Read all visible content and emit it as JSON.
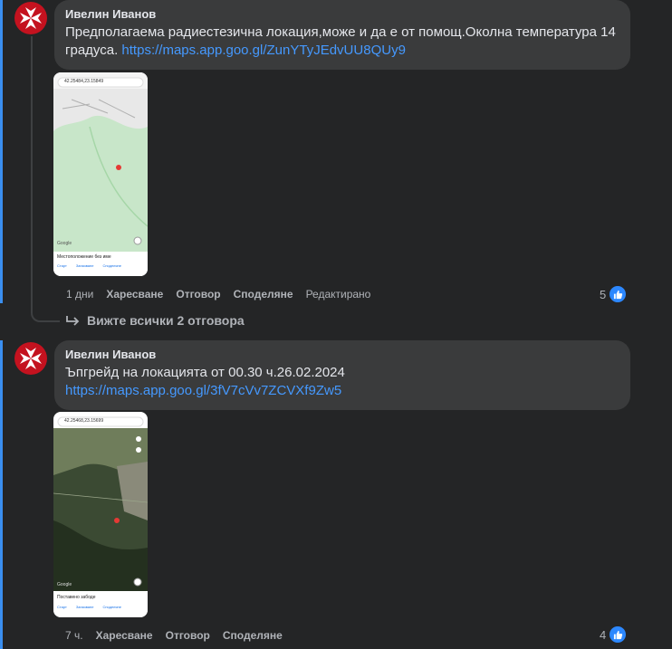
{
  "comment1": {
    "author": "Ивелин Иванов",
    "text_before_link": "Предполагаема радиестезична локация,може и да е от помощ.Околна температура 14 градуса. ",
    "link": "https://maps.app.goo.gl/ZunYTyJEdvUU8QUy9",
    "thumb": {
      "search_text": "42.25484,23.15849",
      "bottom_text": "Местоположение без име",
      "action1": "Старт",
      "action2": "Запазване",
      "action3": "Споделяне",
      "brand": "Google"
    },
    "time": "1 дни",
    "like_label": "Харесване",
    "reply_label": "Отговор",
    "share_label": "Споделяне",
    "edited_label": "Редактирано",
    "reaction_count": "5"
  },
  "view_replies": "Вижте всички 2 отговора",
  "comment2": {
    "author": "Ивелин Иванов",
    "text_before_link": "Ъпгрейд на локацията от 00.30 ч.26.02.2024 ",
    "link": "https://maps.app.goo.gl/3fV7cVv7ZCVXf9Zw5",
    "thumb": {
      "search_text": "42.25468,23.15699",
      "bottom_text": "Поставено забоде",
      "action1": "Старт",
      "action2": "Запазване",
      "action3": "Споделяне",
      "brand": "Google"
    },
    "time": "7 ч.",
    "like_label": "Харесване",
    "reply_label": "Отговор",
    "share_label": "Споделяне",
    "reaction_count": "4"
  },
  "colors": {
    "background": "#242526",
    "bubble": "#3a3b3c",
    "link": "#4599ff",
    "like": "#2d88ff",
    "avatar": "#c4121f",
    "accent": "#3a8ff0"
  }
}
